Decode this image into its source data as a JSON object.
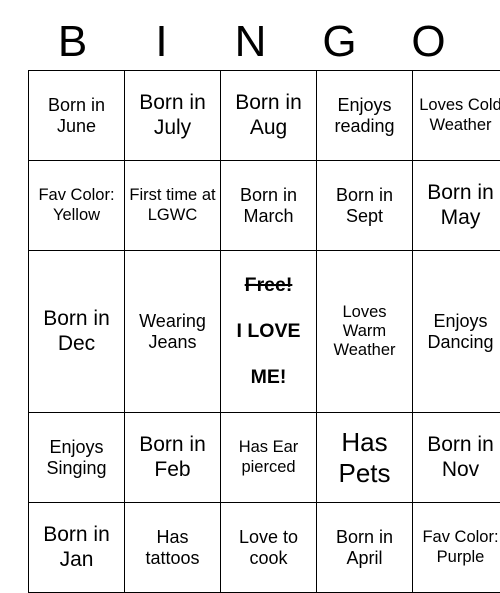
{
  "card": {
    "title": "BINGO",
    "header_letters": [
      "B",
      "I",
      "N",
      "G",
      "O"
    ],
    "colors": {
      "background": "#ffffff",
      "text": "#000000",
      "border": "#000000"
    },
    "rows": [
      [
        {
          "text": "Born in June",
          "size": "sm"
        },
        {
          "text": "Born in July",
          "size": "md"
        },
        {
          "text": "Born in Aug",
          "size": "md"
        },
        {
          "text": "Enjoys reading",
          "size": "sm"
        },
        {
          "text": "Loves Cold Weather",
          "size": "xs"
        }
      ],
      [
        {
          "text": "Fav Color: Yellow",
          "size": "xs"
        },
        {
          "text": "First time at LGWC",
          "size": "xs"
        },
        {
          "text": "Born in March",
          "size": "sm"
        },
        {
          "text": "Born in Sept",
          "size": "sm"
        },
        {
          "text": "Born in May",
          "size": "md"
        }
      ],
      [
        {
          "text": "Born in Dec",
          "size": "md"
        },
        {
          "text": "Wearing Jeans",
          "size": "sm"
        },
        {
          "free": true,
          "line_1": "Free!",
          "line_2": "I LOVE",
          "line_3": "ME!",
          "line_1_strikethrough": true
        },
        {
          "text": "Loves Warm Weather",
          "size": "xs"
        },
        {
          "text": "Enjoys Dancing",
          "size": "sm"
        }
      ],
      [
        {
          "text": "Enjoys Singing",
          "size": "sm"
        },
        {
          "text": "Born in Feb",
          "size": "md"
        },
        {
          "text": "Has Ear pierced",
          "size": "xs"
        },
        {
          "text": "Has Pets",
          "size": "lg"
        },
        {
          "text": "Born in Nov",
          "size": "md"
        }
      ],
      [
        {
          "text": "Born in Jan",
          "size": "md"
        },
        {
          "text": "Has tattoos",
          "size": "sm"
        },
        {
          "text": "Love to cook",
          "size": "sm"
        },
        {
          "text": "Born in April",
          "size": "sm"
        },
        {
          "text": "Fav Color: Purple",
          "size": "xs"
        }
      ]
    ]
  }
}
